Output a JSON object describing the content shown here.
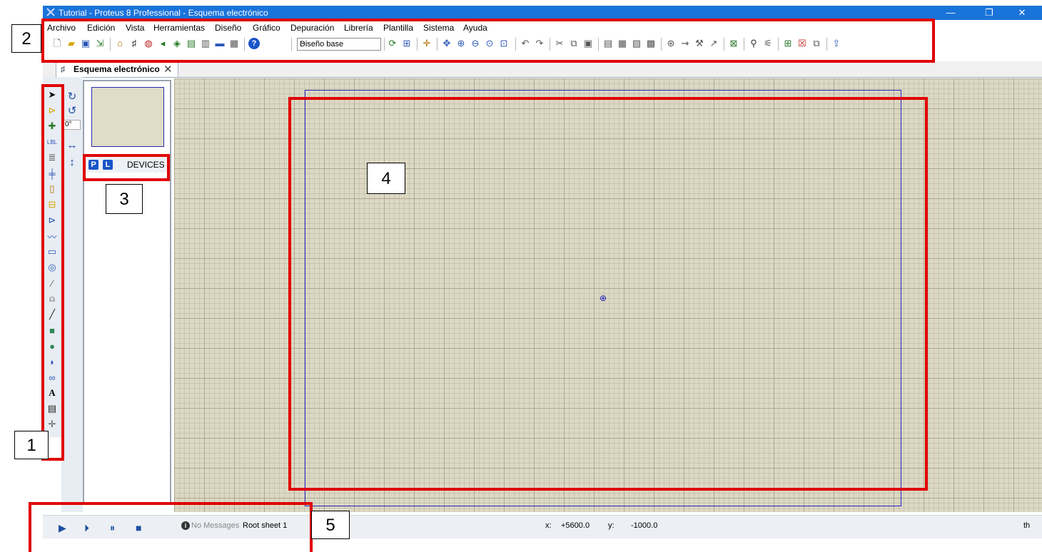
{
  "window": {
    "title": "Tutorial - Proteus 8 Professional - Esquema electrónico",
    "minimize_glyph": "—",
    "restore_glyph": "❐",
    "close_glyph": "✕"
  },
  "menu": [
    "Archivo",
    "Edición",
    "Vista",
    "Herramientas",
    "Diseño",
    "Gráfico",
    "Depuración",
    "Librería",
    "Plantilla",
    "Sistema",
    "Ayuda"
  ],
  "toolbar": {
    "design_select_value": "Diseño base",
    "icons": [
      "new-file-icon",
      "open-folder-icon",
      "save-icon",
      "import-icon",
      "home-icon",
      "schematic-icon",
      "pcb-icon",
      "gerber-icon",
      "3d-icon",
      "bom-icon",
      "notes-icon",
      "design-explorer-icon",
      "help-icon",
      "refresh-icon",
      "grid-icon",
      "origin-icon",
      "pan-icon",
      "zoom-in-icon",
      "zoom-out-icon",
      "zoom-all-icon",
      "zoom-area-icon",
      "undo-icon",
      "redo-icon",
      "cut-icon",
      "copy-icon",
      "paste-icon",
      "block-copy-icon",
      "block-move-icon",
      "block-rotate-icon",
      "block-delete-icon",
      "pick-device-icon",
      "make-device-icon",
      "packaging-icon",
      "decompose-icon",
      "wire-autorouter-icon",
      "search-icon",
      "property-tool-icon",
      "new-sheet-icon",
      "delete-sheet-icon",
      "goto-sheet-icon",
      "export-icon"
    ]
  },
  "tab": {
    "label": "Esquema electrónico"
  },
  "left_tools": [
    "selection-icon",
    "component-icon",
    "junction-icon",
    "wire-label-icon",
    "text-script-icon",
    "bus-icon",
    "subcircuit-icon",
    "terminal-icon",
    "device-pin-icon",
    "graph-icon",
    "tape-recorder-icon",
    "generator-icon",
    "voltage-probe-icon",
    "current-probe-icon",
    "line-icon",
    "box-icon",
    "circle-icon",
    "arc-icon",
    "path-icon",
    "text-icon",
    "symbol-icon",
    "marker-icon"
  ],
  "rotation": {
    "angle": "0°"
  },
  "devices_panel": {
    "p_label": "P",
    "l_label": "L",
    "title": "DEVICES"
  },
  "status": {
    "messages": "No Messages",
    "sheet": "Root sheet 1",
    "x_label": "x:",
    "x_value": "+5600.0",
    "y_label": "y:",
    "y_value": "-1000.0",
    "unit": "th"
  },
  "annotations": {
    "labels": [
      "1",
      "2",
      "3",
      "4",
      "5"
    ],
    "color": "#e00000"
  },
  "colors": {
    "titlebar": "#1a73d9",
    "canvas": "#dcd8c4",
    "sheet_border": "#2020c0"
  }
}
